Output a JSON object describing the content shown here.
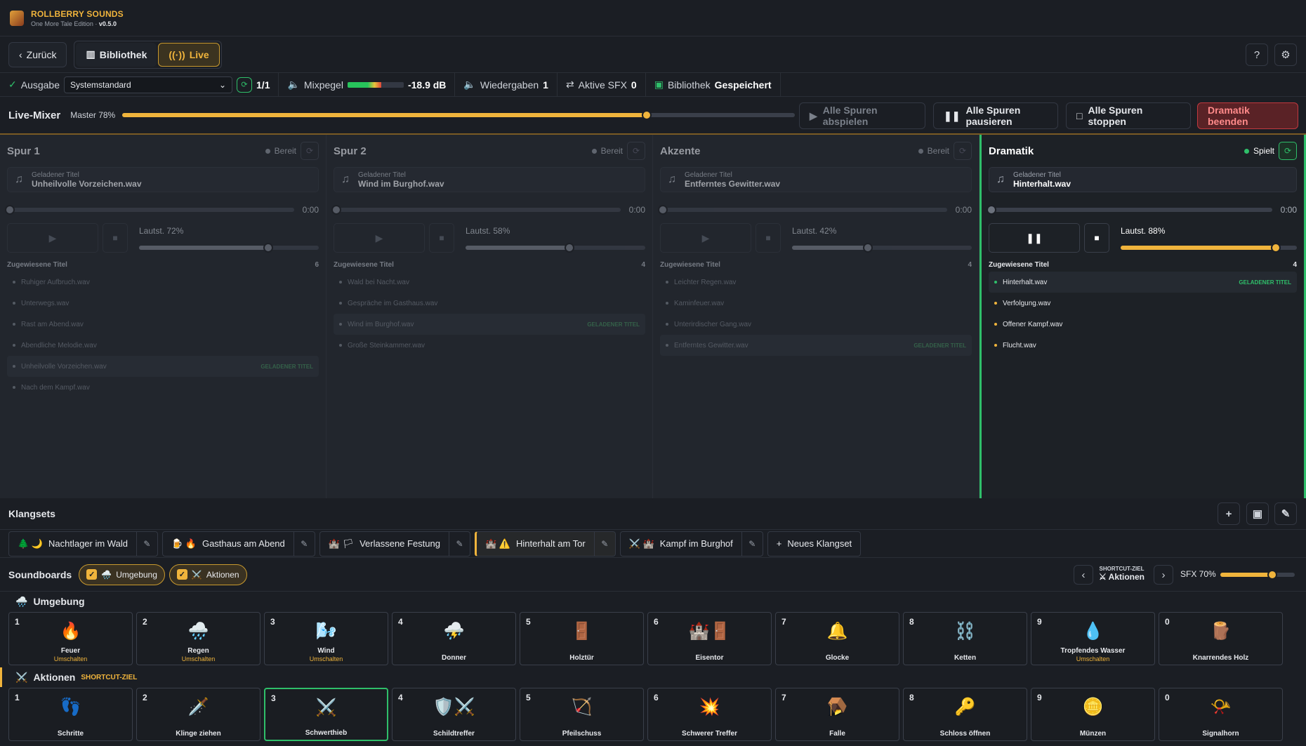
{
  "app": {
    "brand": "ROLLBERRY SOUNDS",
    "edition": "One More Tale Edition",
    "sep": "·",
    "version": "v0.5.0"
  },
  "nav": {
    "back": "Zurück",
    "library": "Bibliothek",
    "live": "Live"
  },
  "status": {
    "output_label": "Ausgabe",
    "output_device": "Systemstandard",
    "output_count": "1/1",
    "mix_label": "Mixpegel",
    "mix_db": "-18.9 dB",
    "mix_level": 0.6,
    "playback_label": "Wiedergaben",
    "playback_count": "1",
    "sfx_label": "Aktive SFX",
    "sfx_count": "0",
    "library_label": "Bibliothek",
    "library_state": "Gespeichert"
  },
  "mixer": {
    "title": "Live-Mixer",
    "master_label": "Master 78%",
    "master_value": 78,
    "play_all": "Alle Spuren abspielen",
    "pause_all": "Alle Spuren pausieren",
    "stop_all": "Alle Spuren stoppen",
    "end": "Dramatik beenden"
  },
  "tracks": [
    {
      "name": "Spur 1",
      "state": "Bereit",
      "loaded_label": "Geladener Titel",
      "loaded": "Unheilvolle Vorzeichen.wav",
      "time": "0:00",
      "volume_label": "Lautst. 72%",
      "volume": 72,
      "assigned_label": "Zugewiesene Titel",
      "count": "6",
      "items": [
        "Ruhiger Aufbruch.wav",
        "Unterwegs.wav",
        "Rast am Abend.wav",
        "Abendliche Melodie.wav",
        "Unheilvolle Vorzeichen.wav",
        "Nach dem Kampf.wav"
      ],
      "current": 4
    },
    {
      "name": "Spur 2",
      "state": "Bereit",
      "loaded_label": "Geladener Titel",
      "loaded": "Wind im Burghof.wav",
      "time": "0:00",
      "volume_label": "Lautst. 58%",
      "volume": 58,
      "assigned_label": "Zugewiesene Titel",
      "count": "4",
      "items": [
        "Wald bei Nacht.wav",
        "Gespräche im Gasthaus.wav",
        "Wind im Burghof.wav",
        "Große Steinkammer.wav"
      ],
      "current": 2
    },
    {
      "name": "Akzente",
      "state": "Bereit",
      "loaded_label": "Geladener Titel",
      "loaded": "Entferntes Gewitter.wav",
      "time": "0:00",
      "volume_label": "Lautst. 42%",
      "volume": 42,
      "assigned_label": "Zugewiesene Titel",
      "count": "4",
      "items": [
        "Leichter Regen.wav",
        "Kaminfeuer.wav",
        "Unterirdischer Gang.wav",
        "Entferntes Gewitter.wav"
      ],
      "current": 3
    },
    {
      "name": "Dramatik",
      "state": "Spielt",
      "loaded_label": "Geladener Titel",
      "loaded": "Hinterhalt.wav",
      "time": "0:00",
      "volume_label": "Lautst. 88%",
      "volume": 88,
      "assigned_label": "Zugewiesene Titel",
      "count": "4",
      "items": [
        "Hinterhalt.wav",
        "Verfolgung.wav",
        "Offener Kampf.wav",
        "Flucht.wav"
      ],
      "current": 0
    }
  ],
  "loaded_tag": "GELADENER TITEL",
  "klangsets": {
    "title": "Klangsets",
    "new": "Neues Klangset",
    "items": [
      {
        "name": "Nachtlager im Wald",
        "icons": "🌲 🌙"
      },
      {
        "name": "Gasthaus am Abend",
        "icons": "🍺 🔥"
      },
      {
        "name": "Verlassene Festung",
        "icons": "🏰 🏳"
      },
      {
        "name": "Hinterhalt am Tor",
        "icons": "🏰 ⚠️"
      },
      {
        "name": "Kampf im Burghof",
        "icons": "⚔️ 🏰"
      }
    ]
  },
  "soundboards": {
    "title": "Soundboards",
    "chip1": "Umgebung",
    "chip2": "Aktionen",
    "shortcut_label": "SHORTCUT-ZIEL",
    "shortcut_value": "Aktionen",
    "sfx_label": "SFX 70%",
    "sfx_value": 70
  },
  "cat1": {
    "title": "Umgebung",
    "icon": "🌧️",
    "tiles": [
      {
        "n": "1",
        "icon": "🔥",
        "t": "Feuer",
        "s": "Umschalten"
      },
      {
        "n": "2",
        "icon": "🌧️",
        "t": "Regen",
        "s": "Umschalten"
      },
      {
        "n": "3",
        "icon": "🌬️",
        "t": "Wind",
        "s": "Umschalten"
      },
      {
        "n": "4",
        "icon": "⛈️",
        "t": "Donner",
        "s": ""
      },
      {
        "n": "5",
        "icon": "🚪",
        "t": "Holztür",
        "s": ""
      },
      {
        "n": "6",
        "icon": "🏰🚪",
        "t": "Eisentor",
        "s": ""
      },
      {
        "n": "7",
        "icon": "🔔",
        "t": "Glocke",
        "s": ""
      },
      {
        "n": "8",
        "icon": "⛓️",
        "t": "Ketten",
        "s": ""
      },
      {
        "n": "9",
        "icon": "💧",
        "t": "Tropfendes Wasser",
        "s": "Umschalten"
      },
      {
        "n": "0",
        "icon": "🪵",
        "t": "Knarrendes Holz",
        "s": ""
      }
    ]
  },
  "cat2": {
    "title": "Aktionen",
    "icon": "⚔️",
    "tag": "SHORTCUT-ZIEL",
    "tiles": [
      {
        "n": "1",
        "icon": "👣",
        "t": "Schritte",
        "s": ""
      },
      {
        "n": "2",
        "icon": "🗡️",
        "t": "Klinge ziehen",
        "s": ""
      },
      {
        "n": "3",
        "icon": "⚔️",
        "t": "Schwerthieb",
        "s": ""
      },
      {
        "n": "4",
        "icon": "🛡️⚔️",
        "t": "Schildtreffer",
        "s": ""
      },
      {
        "n": "5",
        "icon": "🏹",
        "t": "Pfeilschuss",
        "s": ""
      },
      {
        "n": "6",
        "icon": "💥",
        "t": "Schwerer Treffer",
        "s": ""
      },
      {
        "n": "7",
        "icon": "🪤",
        "t": "Falle",
        "s": ""
      },
      {
        "n": "8",
        "icon": "🔑",
        "t": "Schloss öffnen",
        "s": ""
      },
      {
        "n": "9",
        "icon": "🪙",
        "t": "Münzen",
        "s": ""
      },
      {
        "n": "0",
        "icon": "📯",
        "t": "Signalhorn",
        "s": ""
      }
    ],
    "selected": 2
  }
}
